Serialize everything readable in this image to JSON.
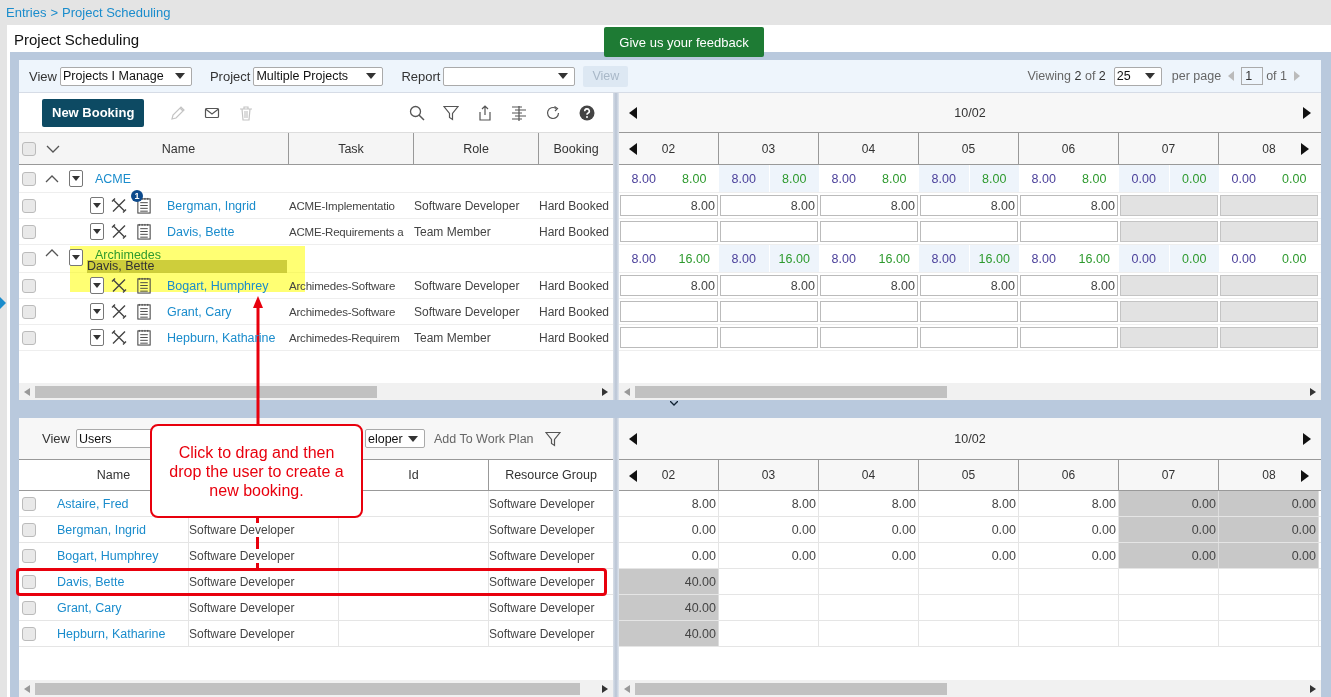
{
  "breadcrumb": {
    "items": [
      "Entries",
      "Project Scheduling"
    ],
    "separator": ">"
  },
  "page_title": "Project Scheduling",
  "feedback_button": "Give us your feedback",
  "filters": {
    "view": {
      "label": "View",
      "value": "Projects I Manage"
    },
    "project": {
      "label": "Project",
      "value": "Multiple Projects"
    },
    "report": {
      "label": "Report"
    },
    "view_button": {
      "label": "View",
      "disabled": true
    }
  },
  "pager": {
    "viewing": "Viewing **2** of **2**",
    "per_page_value": "25",
    "per_page_label": "per page",
    "page": "1",
    "of": "of 1"
  },
  "bookings": {
    "new_button": "New Booking",
    "all_checked": false,
    "columns": [
      "Name",
      "Task",
      "Role",
      "Booking"
    ],
    "month": "10/02",
    "days": [
      "02",
      "03",
      "04",
      "05",
      "06",
      "07",
      "08"
    ],
    "groups": [
      {
        "name": "ACME",
        "expanded": true,
        "checked": false,
        "drop_target": false,
        "totals": [
          [
            "8.00",
            "8.00"
          ],
          [
            "8.00",
            "8.00"
          ],
          [
            "8.00",
            "8.00"
          ],
          [
            "8.00",
            "8.00"
          ],
          [
            "8.00",
            "8.00"
          ],
          [
            "0.00",
            "0.00"
          ],
          [
            "0.00",
            "0.00"
          ]
        ],
        "children": [
          {
            "name": "Bergman, Ingrid",
            "badge": "1",
            "task": "ACME-Implementatio",
            "role": "Software Developer",
            "booking": "Hard Booked",
            "checked": false,
            "hours": [
              {
                "value": "8.00",
                "disabled": false
              },
              {
                "value": "8.00",
                "disabled": false
              },
              {
                "value": "8.00",
                "disabled": false
              },
              {
                "value": "8.00",
                "disabled": false
              },
              {
                "value": "8.00",
                "disabled": false
              },
              {
                "disabled": true
              },
              {
                "disabled": true
              }
            ]
          },
          {
            "name": "Davis, Bette",
            "task": "ACME-Requirements a",
            "role": "Team Member",
            "booking": "Hard Booked",
            "checked": false,
            "hours": [
              {
                "disabled": false
              },
              {
                "disabled": false
              },
              {
                "disabled": false
              },
              {
                "disabled": false
              },
              {
                "disabled": false
              },
              {
                "disabled": true
              },
              {
                "disabled": true
              }
            ]
          }
        ]
      },
      {
        "name": "Archimedes",
        "expanded": true,
        "checked": false,
        "drop_target": true,
        "dragged_item": "Davis, Bette",
        "totals": [
          [
            "8.00",
            "16.00"
          ],
          [
            "8.00",
            "16.00"
          ],
          [
            "8.00",
            "16.00"
          ],
          [
            "8.00",
            "16.00"
          ],
          [
            "8.00",
            "16.00"
          ],
          [
            "0.00",
            "0.00"
          ],
          [
            "0.00",
            "0.00"
          ]
        ],
        "children": [
          {
            "name": "Bogart, Humphrey",
            "task": "Archimedes-Software",
            "role": "Software Developer",
            "booking": "Hard Booked",
            "checked": false,
            "hours": [
              {
                "value": "8.00",
                "disabled": false
              },
              {
                "value": "8.00",
                "disabled": false
              },
              {
                "value": "8.00",
                "disabled": false
              },
              {
                "value": "8.00",
                "disabled": false
              },
              {
                "value": "8.00",
                "disabled": false
              },
              {
                "disabled": true
              },
              {
                "disabled": true
              }
            ]
          },
          {
            "name": "Grant, Cary",
            "task": "Archimedes-Software",
            "role": "Software Developer",
            "booking": "Hard Booked",
            "checked": false,
            "hours": [
              {
                "disabled": false
              },
              {
                "disabled": false
              },
              {
                "disabled": false
              },
              {
                "disabled": false
              },
              {
                "disabled": false
              },
              {
                "disabled": true
              },
              {
                "disabled": true
              }
            ]
          },
          {
            "name": "Hepburn, Katharine",
            "task": "Archimedes-Requirem",
            "role": "Team Member",
            "booking": "Hard Booked",
            "checked": false,
            "hours": [
              {
                "disabled": false
              },
              {
                "disabled": false
              },
              {
                "disabled": false
              },
              {
                "disabled": false
              },
              {
                "disabled": false
              },
              {
                "disabled": true
              },
              {
                "disabled": true
              }
            ]
          }
        ]
      }
    ]
  },
  "users": {
    "view_label": "View",
    "view_value": "Users",
    "role_value": "eloper",
    "add_label": "Add To Work Plan",
    "columns": {
      "name": "Name",
      "id": "Id",
      "resource_group": "Resource Group"
    },
    "month": "10/02",
    "days": [
      "02",
      "03",
      "04",
      "05",
      "06",
      "07",
      "08"
    ],
    "rows": [
      {
        "name": "Astaire, Fred",
        "resource_group": "Software Developer",
        "checked": false,
        "highlighted": false,
        "hours": [
          {
            "value": "8.00",
            "shaded": false
          },
          {
            "value": "8.00",
            "shaded": false
          },
          {
            "value": "8.00",
            "shaded": false
          },
          {
            "value": "8.00",
            "shaded": false
          },
          {
            "value": "8.00",
            "shaded": false
          },
          {
            "value": "0.00",
            "shaded": true
          },
          {
            "value": "0.00",
            "shaded": true
          }
        ]
      },
      {
        "name": "Bergman, Ingrid",
        "role": "Software Developer",
        "resource_group": "Software Developer",
        "checked": false,
        "highlighted": false,
        "hours": [
          {
            "value": "0.00",
            "shaded": false
          },
          {
            "value": "0.00",
            "shaded": false
          },
          {
            "value": "0.00",
            "shaded": false
          },
          {
            "value": "0.00",
            "shaded": false
          },
          {
            "value": "0.00",
            "shaded": false
          },
          {
            "value": "0.00",
            "shaded": true
          },
          {
            "value": "0.00",
            "shaded": true
          }
        ]
      },
      {
        "name": "Bogart, Humphrey",
        "role": "Software Developer",
        "resource_group": "Software Developer",
        "checked": false,
        "highlighted": false,
        "hours": [
          {
            "value": "0.00",
            "shaded": false
          },
          {
            "value": "0.00",
            "shaded": false
          },
          {
            "value": "0.00",
            "shaded": false
          },
          {
            "value": "0.00",
            "shaded": false
          },
          {
            "value": "0.00",
            "shaded": false
          },
          {
            "value": "0.00",
            "shaded": true
          },
          {
            "value": "0.00",
            "shaded": true
          }
        ]
      },
      {
        "name": "Davis, Bette",
        "role": "Software Developer",
        "resource_group": "Software Developer",
        "checked": false,
        "highlighted": true,
        "hours": [
          {
            "value": "40.00",
            "shaded": true
          },
          {
            "shaded": false
          },
          {
            "shaded": false
          },
          {
            "shaded": false
          },
          {
            "shaded": false
          },
          {
            "shaded": false
          },
          {
            "shaded": false
          }
        ]
      },
      {
        "name": "Grant, Cary",
        "role": "Software Developer",
        "resource_group": "Software Developer",
        "checked": false,
        "highlighted": false,
        "hours": [
          {
            "value": "40.00",
            "shaded": true
          },
          {
            "shaded": false
          },
          {
            "shaded": false
          },
          {
            "shaded": false
          },
          {
            "shaded": false
          },
          {
            "shaded": false
          },
          {
            "shaded": false
          }
        ]
      },
      {
        "name": "Hepburn, Katharine",
        "role": "Software Developer",
        "resource_group": "Software Developer",
        "checked": false,
        "highlighted": false,
        "hours": [
          {
            "value": "40.00",
            "shaded": true
          },
          {
            "shaded": false
          },
          {
            "shaded": false
          },
          {
            "shaded": false
          },
          {
            "shaded": false
          },
          {
            "shaded": false
          },
          {
            "shaded": false
          }
        ]
      }
    ]
  },
  "callout": {
    "text": "Click to drag and then drop the user to create a new booking."
  }
}
